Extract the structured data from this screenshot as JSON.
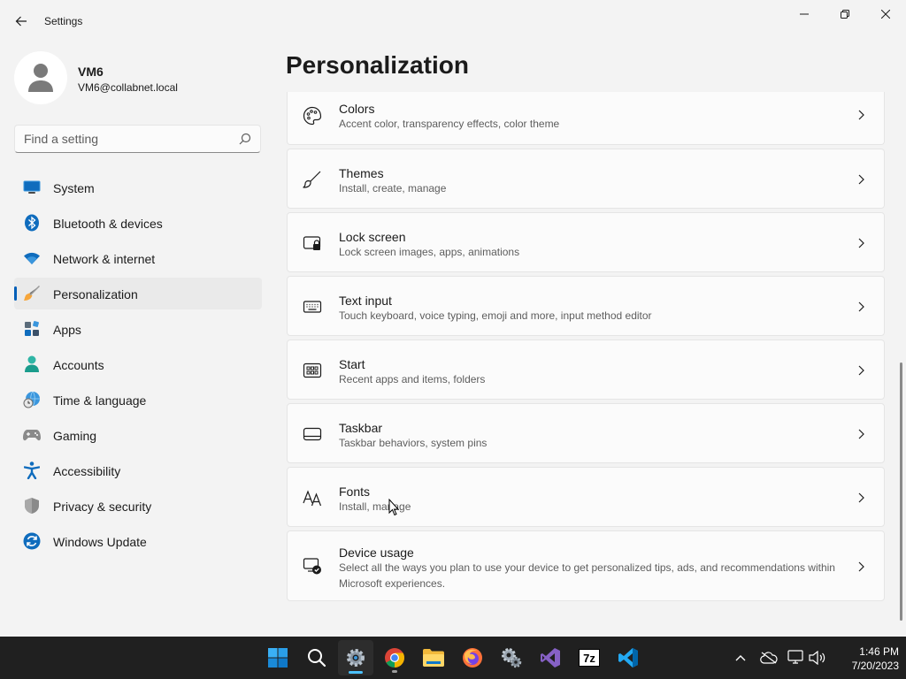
{
  "window": {
    "title": "Settings"
  },
  "profile": {
    "name": "VM6",
    "email": "VM6@collabnet.local"
  },
  "search": {
    "placeholder": "Find a setting"
  },
  "sidebar": {
    "items": [
      {
        "label": "System",
        "icon": "system-icon",
        "active": false
      },
      {
        "label": "Bluetooth & devices",
        "icon": "bluetooth-icon",
        "active": false
      },
      {
        "label": "Network & internet",
        "icon": "wifi-icon",
        "active": false
      },
      {
        "label": "Personalization",
        "icon": "brush-icon",
        "active": true
      },
      {
        "label": "Apps",
        "icon": "apps-icon",
        "active": false
      },
      {
        "label": "Accounts",
        "icon": "accounts-icon",
        "active": false
      },
      {
        "label": "Time & language",
        "icon": "globe-clock-icon",
        "active": false
      },
      {
        "label": "Gaming",
        "icon": "gamepad-icon",
        "active": false
      },
      {
        "label": "Accessibility",
        "icon": "accessibility-icon",
        "active": false
      },
      {
        "label": "Privacy & security",
        "icon": "shield-icon",
        "active": false
      },
      {
        "label": "Windows Update",
        "icon": "update-icon",
        "active": false
      }
    ]
  },
  "main": {
    "title": "Personalization",
    "cards": [
      {
        "title": "Colors",
        "desc": "Accent color, transparency effects, color theme",
        "icon": "palette-icon"
      },
      {
        "title": "Themes",
        "desc": "Install, create, manage",
        "icon": "brush-icon"
      },
      {
        "title": "Lock screen",
        "desc": "Lock screen images, apps, animations",
        "icon": "lock-screen-icon"
      },
      {
        "title": "Text input",
        "desc": "Touch keyboard, voice typing, emoji and more, input method editor",
        "icon": "keyboard-icon"
      },
      {
        "title": "Start",
        "desc": "Recent apps and items, folders",
        "icon": "start-icon"
      },
      {
        "title": "Taskbar",
        "desc": "Taskbar behaviors, system pins",
        "icon": "taskbar-icon"
      },
      {
        "title": "Fonts",
        "desc": "Install, manage",
        "icon": "fonts-icon"
      },
      {
        "title": "Device usage",
        "desc": "Select all the ways you plan to use your device to get personalized tips, ads, and recommendations within Microsoft experiences.",
        "icon": "device-usage-icon"
      }
    ]
  },
  "taskbar": {
    "apps": [
      {
        "name": "start-button",
        "icon": "windows-logo-icon"
      },
      {
        "name": "search-button",
        "icon": "search-icon"
      },
      {
        "name": "settings-app",
        "icon": "gear-icon",
        "active": true
      },
      {
        "name": "chrome-app",
        "icon": "chrome-icon"
      },
      {
        "name": "file-explorer-app",
        "icon": "folder-icon"
      },
      {
        "name": "firefox-app",
        "icon": "firefox-icon"
      },
      {
        "name": "control-panel-app",
        "icon": "control-panel-icon"
      },
      {
        "name": "visual-studio-app",
        "icon": "visual-studio-icon"
      },
      {
        "name": "7zip-app",
        "icon": "7zip-icon"
      },
      {
        "name": "vscode-app",
        "icon": "vscode-icon"
      }
    ],
    "sevenzip_label": "7z",
    "time": "1:46 PM",
    "date": "7/20/2023"
  },
  "colors": {
    "accent": "#005fb8",
    "taskbar": "#202020",
    "background": "#f3f3f3",
    "card": "#fbfbfb"
  }
}
